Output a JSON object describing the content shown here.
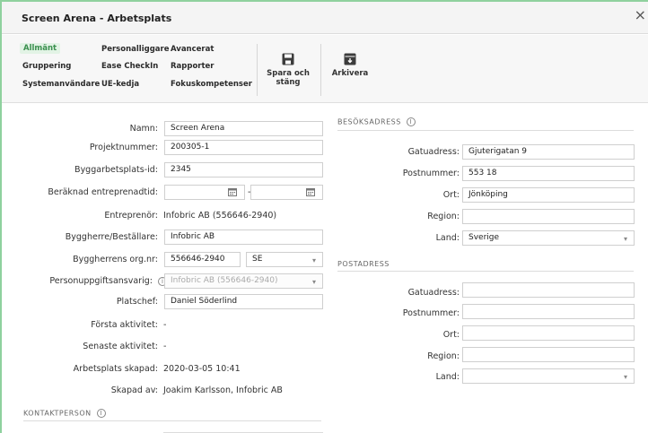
{
  "window": {
    "title": "Screen Arena - Arbetsplats",
    "close_glyph": "×"
  },
  "ribbon": {
    "nav": [
      {
        "id": "allmant",
        "label": "Allmänt",
        "active": true
      },
      {
        "id": "gruppering",
        "label": "Gruppering"
      },
      {
        "id": "systemanvandare",
        "label": "Systemanvändare"
      },
      {
        "id": "personalliggare",
        "label": "Personalliggare"
      },
      {
        "id": "ease-checkin",
        "label": "Ease CheckIn"
      },
      {
        "id": "ue-kedja",
        "label": "UE-kedja"
      },
      {
        "id": "avancerat",
        "label": "Avancerat"
      },
      {
        "id": "rapporter",
        "label": "Rapporter"
      },
      {
        "id": "fokuskompetenser",
        "label": "Fokuskompetenser"
      }
    ],
    "save": {
      "label_line1": "Spara och",
      "label_line2": "stäng",
      "icon": "save-icon"
    },
    "archive": {
      "label": "Arkivera",
      "icon": "archive-icon"
    }
  },
  "form": {
    "namn": {
      "label": "Namn:",
      "value": "Screen Arena"
    },
    "projektnummer": {
      "label": "Projektnummer:",
      "value": "200305-1"
    },
    "byggarbetsplats_id": {
      "label": "Byggarbetsplats-id:",
      "value": "2345"
    },
    "entreprenadtid": {
      "label": "Beräknad entreprenadtid:",
      "from": "",
      "to": "",
      "separator": "-"
    },
    "entreprenor": {
      "label": "Entreprenör:",
      "value": "Infobric AB (556646-2940)"
    },
    "byggherre": {
      "label": "Byggherre/Beställare:",
      "value": "Infobric AB"
    },
    "orgnr": {
      "label": "Byggherrens org.nr:",
      "value": "556646-2940",
      "country": "SE"
    },
    "personuppgiftsansvarig": {
      "label": "Personuppgiftsansvarig:",
      "value": "Infobric AB (556646-2940)"
    },
    "platschef": {
      "label": "Platschef:",
      "value": "Daniel Söderlind"
    },
    "forsta_aktivitet": {
      "label": "Första aktivitet:",
      "value": "-"
    },
    "senaste_aktivitet": {
      "label": "Senaste aktivitet:",
      "value": "-"
    },
    "skapad": {
      "label": "Arbetsplats skapad:",
      "value": "2020-03-05 10:41"
    },
    "skapad_av": {
      "label": "Skapad av:",
      "value": "Joakim Karlsson, Infobric AB"
    }
  },
  "kontakt": {
    "title": "KONTAKTPERSON"
  },
  "besoksadress": {
    "title": "BESÖKSADRESS",
    "gatuadress": {
      "label": "Gatuadress:",
      "value": "Gjuterigatan 9"
    },
    "postnummer": {
      "label": "Postnummer:",
      "value": "553 18"
    },
    "ort": {
      "label": "Ort:",
      "value": "Jönköping"
    },
    "region": {
      "label": "Region:",
      "value": ""
    },
    "land": {
      "label": "Land:",
      "value": "Sverige"
    }
  },
  "postadress": {
    "title": "POSTADRESS",
    "gatuadress": {
      "label": "Gatuadress:",
      "value": ""
    },
    "postnummer": {
      "label": "Postnummer:",
      "value": ""
    },
    "ort": {
      "label": "Ort:",
      "value": ""
    },
    "region": {
      "label": "Region:",
      "value": ""
    },
    "land": {
      "label": "Land:",
      "value": ""
    }
  },
  "colors": {
    "accent": "#3a8f4e",
    "accent_bg": "#e2f3e5",
    "border_green": "#8fd19e"
  }
}
